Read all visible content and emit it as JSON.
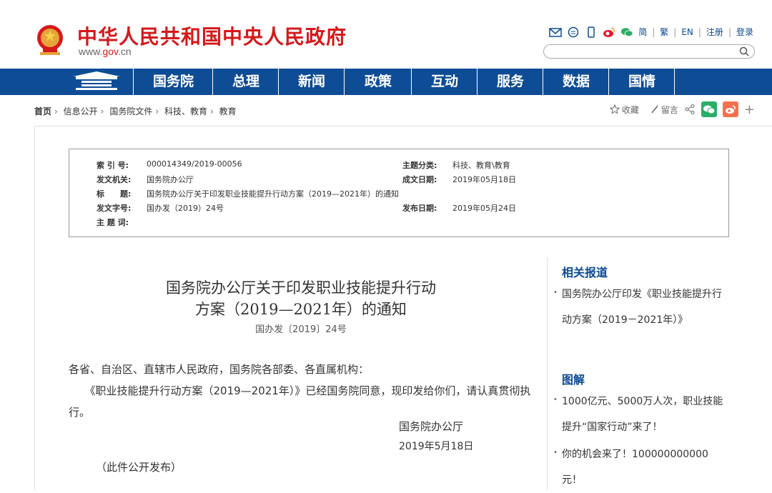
{
  "site": {
    "title": "中华人民共和国中央人民政府",
    "url_prefix": "www.",
    "url_gov": "gov",
    "url_suffix": ".cn"
  },
  "toplinks": [
    "简",
    "繁",
    "EN",
    "注册",
    "登录"
  ],
  "nav": [
    "国务院",
    "总理",
    "新闻",
    "政策",
    "互动",
    "服务",
    "数据",
    "国情"
  ],
  "breadcrumb": [
    "首页",
    "信息公开",
    "国务院文件",
    "科技、教育",
    "教育"
  ],
  "share": {
    "favorite": "收藏",
    "comment": "留言"
  },
  "meta": {
    "index_label": "索 引 号:",
    "index": "000014349/2019-00056",
    "topic_label": "主题分类:",
    "topic": "科技、教育\\教育",
    "issuer_label": "发文机关:",
    "issuer": "国务院办公厅",
    "date_label": "成文日期:",
    "date": "2019年05月18日",
    "title_label": "标　　题:",
    "title": "国务院办公厅关于印发职业技能提升行动方案（2019—2021年）的通知",
    "docnum_label": "发文字号:",
    "docnum": "国办发（2019）24号",
    "pub_label": "发布日期:",
    "pub": "2019年05月24日",
    "keywords_label": "主 题 词:"
  },
  "article": {
    "title_line1": "国务院办公厅关于印发职业技能提升行动",
    "title_line2": "方案（2019—2021年）的通知",
    "doc_no": "国办发〔2019〕24号",
    "salutation": "各省、自治区、直辖市人民政府，国务院各部委、各直属机构：",
    "paragraph": "　　《职业技能提升行动方案（2019—2021年）》已经国务院同意，现印发给你们，请认真贯彻执行。",
    "signer": "国务院办公厅",
    "sign_date": "2019年5月18日",
    "public_note": "（此件公开发布）"
  },
  "sidebar": {
    "related_title": "相关报道",
    "related_items": [
      "国务院办公厅印发《职业技能提升行动方案（2019－2021年）》"
    ],
    "graphic_title": "图解",
    "graphic_items": [
      "1000亿元、5000万人次，职业技能提升“国家行动”来了！",
      "你的机会来了！100000000000元！"
    ]
  },
  "colors": {
    "brand_red": "#d6181a",
    "nav_blue": "#0e4c96",
    "link_blue": "#0b4a92",
    "wechat_green": "#2aae67",
    "weibo_orange": "#f5704f"
  }
}
